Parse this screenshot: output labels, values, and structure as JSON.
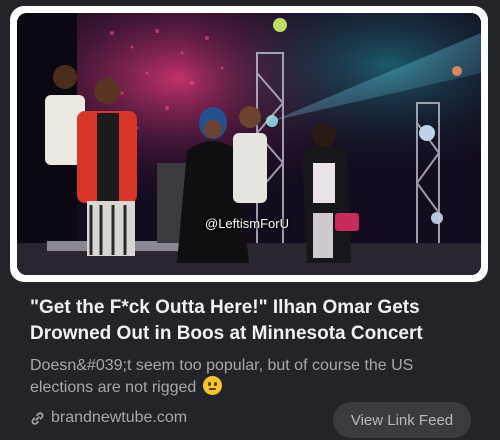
{
  "post": {
    "watermark": "@LeftismForU",
    "title": "\"Get the F*ck Outta Here!\" Ilhan Omar Gets Drowned Out in Boos at Minnesota Concert",
    "description": "Doesn&#039;t seem too popular, but of course the US elections are not rigged",
    "emoji": "thinking-face-emoji",
    "domain": "brandnewtube.com",
    "link_icon": "link-icon",
    "feed_button": "View Link Feed"
  },
  "colors": {
    "background": "#23242a",
    "title": "#f1f1f3",
    "muted": "#a6a7ad",
    "button_bg": "#3a3b40"
  }
}
